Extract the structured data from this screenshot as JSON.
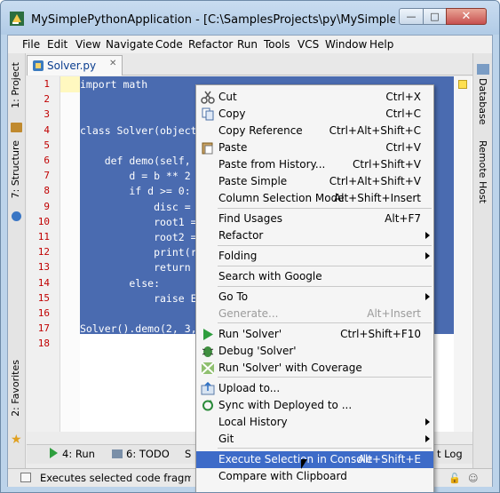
{
  "window": {
    "title": "MySimplePythonApplication - [C:\\SamplesProjects\\py\\MySimplePythonAp",
    "min_glyph": "—",
    "max_glyph": "□",
    "close_glyph": "✕"
  },
  "menubar": [
    "File",
    "Edit",
    "View",
    "Navigate",
    "Code",
    "Refactor",
    "Run",
    "Tools",
    "VCS",
    "Window",
    "Help"
  ],
  "left_tabs": [
    "1: Project",
    "7: Structure",
    "2: Favorites"
  ],
  "right_tabs": [
    "Database",
    "Remote Host"
  ],
  "editor_tab": {
    "label": "Solver.py"
  },
  "gutter_lines": [
    "1",
    "2",
    "3",
    "4",
    "5",
    "6",
    "7",
    "8",
    "9",
    "10",
    "11",
    "12",
    "13",
    "14",
    "15",
    "16",
    "17",
    "18"
  ],
  "code": [
    "import math",
    "",
    "",
    "class Solver(object",
    "",
    "    def demo(self,",
    "        d = b ** 2",
    "        if d >= 0:",
    "            disc =",
    "            root1 =",
    "            root2 =",
    "            print(r",
    "            return",
    "        else:",
    "            raise E",
    "",
    "Solver().demo(2, 3,",
    ""
  ],
  "bottom_tabs": [
    "4: Run",
    "6: TODO",
    "S",
    "t Log"
  ],
  "status": {
    "text": "Executes selected code fragment in"
  },
  "context_menu": {
    "items": [
      {
        "label": "Cut",
        "shortcut": "Ctrl+X",
        "icon": "scissors-icon"
      },
      {
        "label": "Copy",
        "shortcut": "Ctrl+C",
        "icon": "copy-icon"
      },
      {
        "label": "Copy Reference",
        "shortcut": "Ctrl+Alt+Shift+C"
      },
      {
        "label": "Paste",
        "shortcut": "Ctrl+V",
        "icon": "paste-icon"
      },
      {
        "label": "Paste from History...",
        "shortcut": "Ctrl+Shift+V"
      },
      {
        "label": "Paste Simple",
        "shortcut": "Ctrl+Alt+Shift+V"
      },
      {
        "label": "Column Selection Mode",
        "shortcut": "Alt+Shift+Insert"
      },
      {
        "label": "Find Usages",
        "shortcut": "Alt+F7"
      },
      {
        "label": "Refactor",
        "shortcut": ""
      },
      {
        "label": "Folding",
        "shortcut": ""
      },
      {
        "label": "Search with Google",
        "shortcut": ""
      },
      {
        "label": "Go To",
        "shortcut": ""
      },
      {
        "label": "Generate...",
        "shortcut": "Alt+Insert"
      },
      {
        "label": "Run 'Solver'",
        "shortcut": "Ctrl+Shift+F10",
        "icon": "run-icon"
      },
      {
        "label": "Debug 'Solver'",
        "shortcut": "",
        "icon": "debug-icon"
      },
      {
        "label": "Run 'Solver' with Coverage",
        "shortcut": "",
        "icon": "coverage-icon"
      },
      {
        "label": "Upload to...",
        "shortcut": "",
        "icon": "upload-icon"
      },
      {
        "label": "Sync with Deployed to ...",
        "shortcut": "",
        "icon": "sync-icon"
      },
      {
        "label": "Local History",
        "shortcut": ""
      },
      {
        "label": "Git",
        "shortcut": ""
      },
      {
        "label": "Execute Selection in Console",
        "shortcut": "Alt+Shift+E"
      },
      {
        "label": "Compare with Clipboard",
        "shortcut": ""
      }
    ]
  }
}
